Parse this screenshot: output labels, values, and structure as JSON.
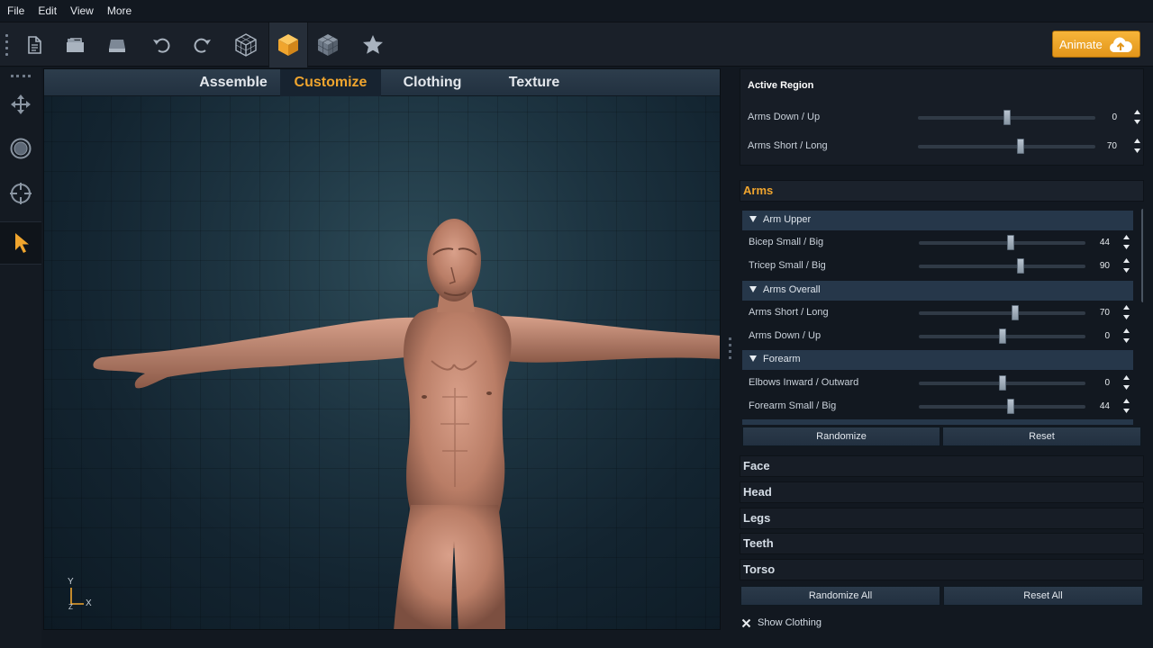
{
  "menu": [
    "File",
    "Edit",
    "View",
    "More"
  ],
  "toolbar": {
    "icons": [
      "new-document-icon",
      "open-folder-icon",
      "save-icon",
      "undo-icon",
      "redo-icon",
      "wireframe-cube-icon",
      "solid-cube-icon",
      "shaded-cube-icon",
      "star-icon"
    ],
    "animate_label": "Animate"
  },
  "left_tools": [
    "move-icon",
    "rotate-icon",
    "target-icon",
    "select-pointer-icon"
  ],
  "tabs": [
    "Assemble",
    "Customize",
    "Clothing",
    "Texture"
  ],
  "active_tab": "Customize",
  "viewport": {
    "axis_y": "Y",
    "axis_x": "X",
    "axis_z": "Z"
  },
  "active_region": {
    "title": "Active Region",
    "rows": [
      {
        "label": "Arms Down / Up",
        "value": 0,
        "fraction": 0.5
      },
      {
        "label": "Arms Short / Long",
        "value": 70,
        "fraction": 0.58
      }
    ]
  },
  "arms": {
    "title": "Arms",
    "groups": [
      {
        "title": "Arm Upper",
        "rows": [
          {
            "label": "Bicep Small / Big",
            "value": 44,
            "fraction": 0.55
          },
          {
            "label": "Tricep Small / Big",
            "value": 90,
            "fraction": 0.61
          }
        ]
      },
      {
        "title": "Arms Overall",
        "rows": [
          {
            "label": "Arms Short / Long",
            "value": 70,
            "fraction": 0.58
          },
          {
            "label": "Arms Down / Up",
            "value": 0,
            "fraction": 0.5
          }
        ]
      },
      {
        "title": "Forearm",
        "rows": [
          {
            "label": "Elbows Inward / Outward",
            "value": 0,
            "fraction": 0.5
          },
          {
            "label": "Forearm Small / Big",
            "value": 44,
            "fraction": 0.55
          }
        ]
      }
    ],
    "randomize_label": "Randomize",
    "reset_label": "Reset"
  },
  "sections": [
    "Face",
    "Head",
    "Legs",
    "Teeth",
    "Torso"
  ],
  "randomize_all_label": "Randomize All",
  "reset_all_label": "Reset All",
  "show_clothing": {
    "label": "Show Clothing",
    "checked": true
  },
  "colors": {
    "accent": "#f0a52e",
    "animate_button": "#f2a833",
    "panel": "#171d26",
    "skin": "#c98c74"
  }
}
